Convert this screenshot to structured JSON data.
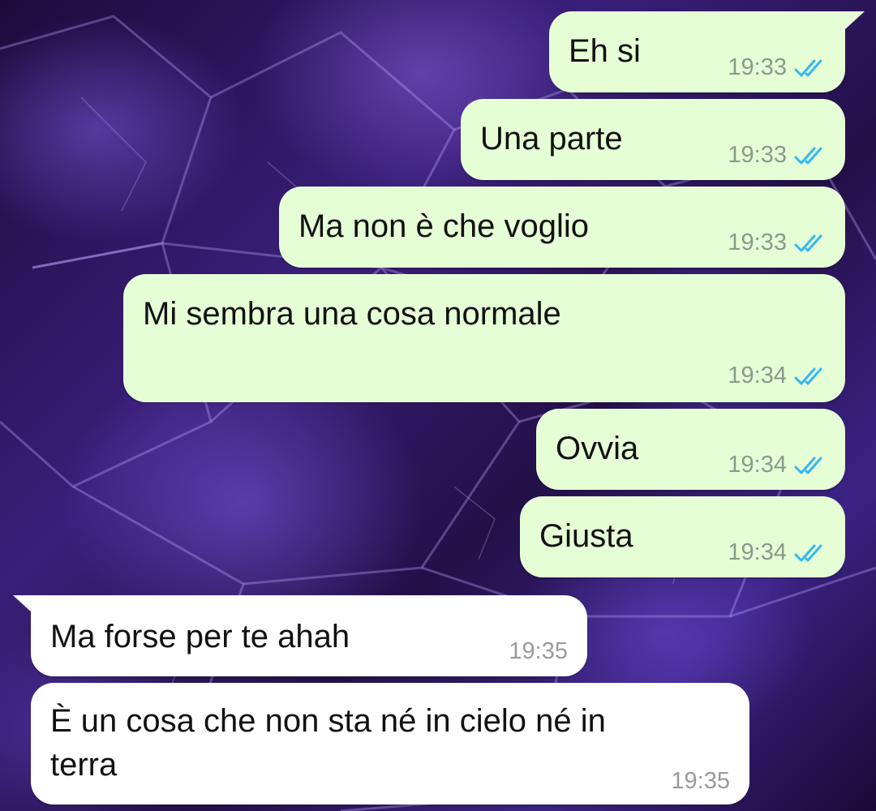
{
  "colors": {
    "outgoing_bubble": "#e6fed6",
    "incoming_bubble": "#ffffff",
    "read_tick": "#34b7f1",
    "wallpaper": "#2a1550"
  },
  "icons": {
    "read_receipt": "double-check-icon"
  },
  "messages": [
    {
      "direction": "outgoing",
      "text": "Eh si",
      "time": "19:33",
      "status": "read"
    },
    {
      "direction": "outgoing",
      "text": "Una parte",
      "time": "19:33",
      "status": "read"
    },
    {
      "direction": "outgoing",
      "text": "Ma non è che voglio",
      "time": "19:33",
      "status": "read"
    },
    {
      "direction": "outgoing",
      "text": "Mi sembra una cosa normale",
      "time": "19:34",
      "status": "read"
    },
    {
      "direction": "outgoing",
      "text": "Ovvia",
      "time": "19:34",
      "status": "read"
    },
    {
      "direction": "outgoing",
      "text": "Giusta",
      "time": "19:34",
      "status": "read"
    },
    {
      "direction": "incoming",
      "text": "Ma forse per te ahah",
      "time": "19:35"
    },
    {
      "direction": "incoming",
      "text_line1": "È un cosa che non sta né in cielo né in",
      "text_line2": "terra",
      "time": "19:35"
    }
  ]
}
